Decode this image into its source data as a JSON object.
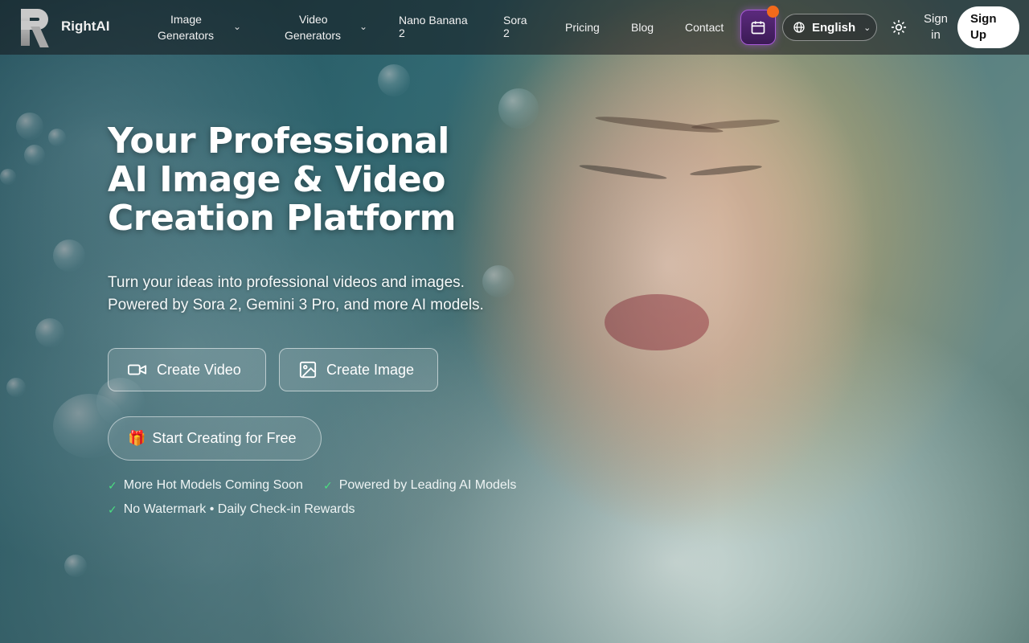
{
  "brand": {
    "name": "RightAI"
  },
  "nav": {
    "items": [
      {
        "label_line1": "Image",
        "label_line2": "Generators",
        "has_dropdown": true
      },
      {
        "label_line1": "Video",
        "label_line2": "Generators",
        "has_dropdown": true
      },
      {
        "label_line1": "Nano Banana",
        "label_line2": "2",
        "has_dropdown": false
      },
      {
        "label_line1": "Sora",
        "label_line2": "2",
        "has_dropdown": false
      },
      {
        "label_line1": "Pricing",
        "label_line2": "",
        "has_dropdown": false
      },
      {
        "label_line1": "Blog",
        "label_line2": "",
        "has_dropdown": false
      },
      {
        "label_line1": "Contact",
        "label_line2": "",
        "has_dropdown": false
      }
    ],
    "checkin_icon": "calendar-icon",
    "language": "English",
    "theme_icon": "sun-icon",
    "signin_line1": "Sign",
    "signin_line2": "in",
    "signup_line1": "Sign",
    "signup_line2": "Up"
  },
  "hero": {
    "headline_lines": [
      "Your Professional",
      "AI Image & Video",
      "Creation Platform"
    ],
    "subline_lines": [
      "Turn your ideas into professional videos and images.",
      "Powered by Sora 2, Gemini 3 Pro, and more AI models."
    ],
    "primary_buttons": [
      {
        "label": "Create Video",
        "icon": "video-camera-icon"
      },
      {
        "label": "Create Image",
        "icon": "image-icon"
      }
    ],
    "free_button": {
      "label": "Start Creating for Free",
      "icon": "gift-icon"
    },
    "features": [
      "More Hot Models Coming Soon",
      "Powered by Leading AI Models",
      "No Watermark • Daily Check-in Rewards"
    ]
  },
  "colors": {
    "checkin_button": "#4a2266",
    "notification_dot": "#f26a1b",
    "check_mark": "#4ade80",
    "signup_bg": "#ffffff"
  }
}
